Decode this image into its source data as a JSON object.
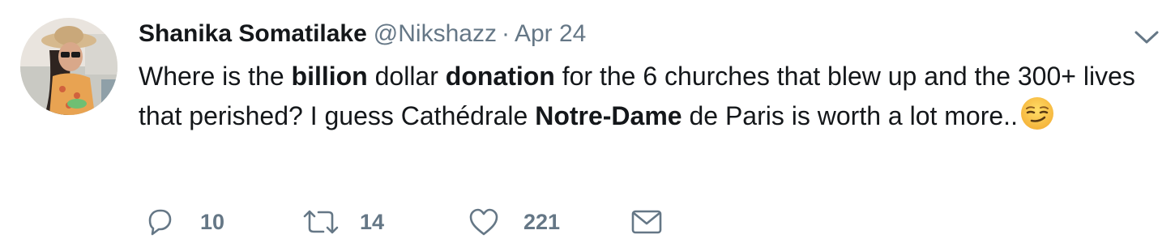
{
  "tweet": {
    "author": {
      "name": "Shanika Somatilake",
      "handle": "@Nikshazz"
    },
    "separator": "·",
    "date": "Apr 24",
    "text": {
      "p1": "Where is the ",
      "b1": "billion",
      "p2": " dollar ",
      "b2": "donation",
      "p3": " for the 6 churches that blew up and the 300+ lives that perished? I guess Cathédrale ",
      "b3": "Notre-Dame",
      "p4": " de Paris is worth a lot more.."
    },
    "emoji": "smirking-face",
    "actions": {
      "reply_count": "10",
      "retweet_count": "14",
      "like_count": "221"
    },
    "colors": {
      "text": "#14171a",
      "secondary": "#657786"
    }
  }
}
